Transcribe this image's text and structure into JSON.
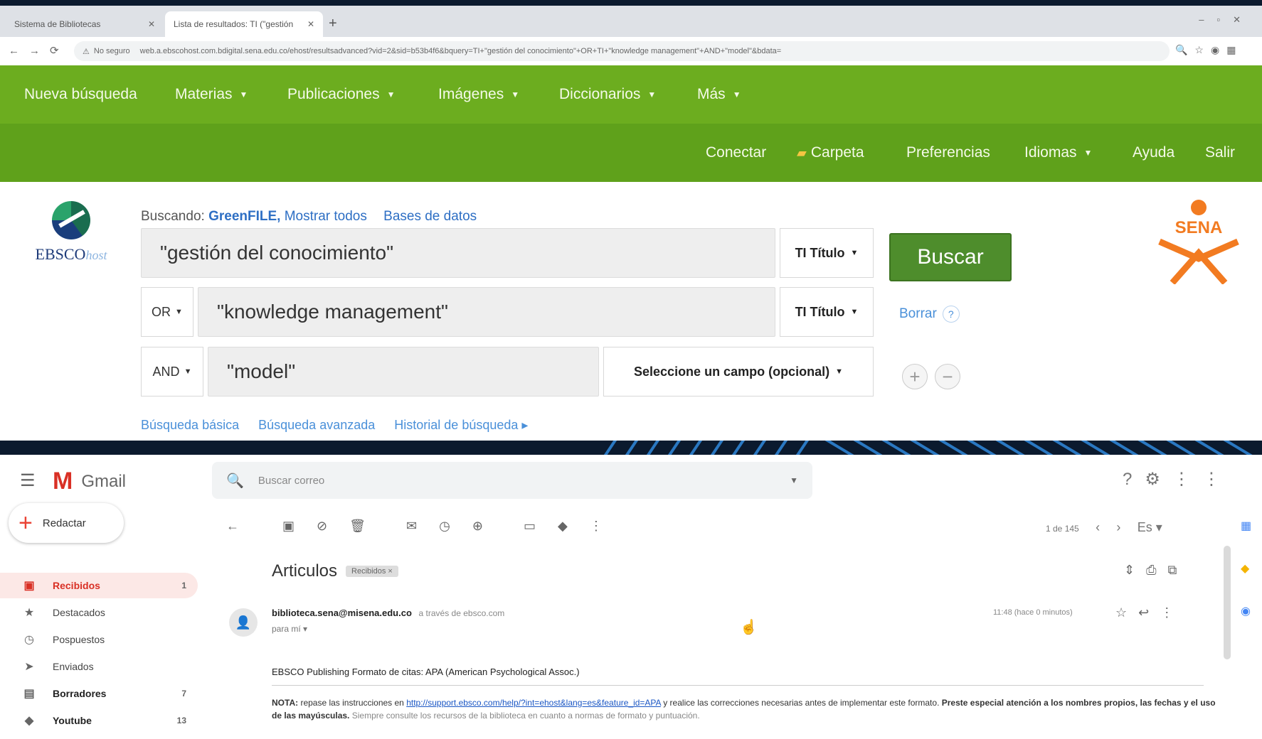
{
  "browser": {
    "tabs": [
      {
        "label": "Sistema de Bibliotecas"
      },
      {
        "label": "Lista de resultados: TI (\"gestión"
      }
    ],
    "url": "web.a.ebscohost.com.bdigital.sena.edu.co/ehost/resultsadvanced?vid=2&sid=b53b4f6&bquery=TI+\"gestión del conocimiento\"+OR+TI+\"knowledge management\"+AND+\"model\"&bdata=",
    "security_label": "No seguro"
  },
  "ebsco": {
    "topnav": [
      {
        "label": "Nueva búsqueda",
        "caret": false
      },
      {
        "label": "Materias",
        "caret": true
      },
      {
        "label": "Publicaciones",
        "caret": true
      },
      {
        "label": "Imágenes",
        "caret": true
      },
      {
        "label": "Diccionarios",
        "caret": true
      },
      {
        "label": "Más",
        "caret": true
      }
    ],
    "usernav": {
      "conectar": "Conectar",
      "carpeta": "Carpeta",
      "preferencias": "Preferencias",
      "idiomas": "Idiomas",
      "ayuda": "Ayuda",
      "salir": "Salir"
    },
    "logo": {
      "brand": "EBSCO",
      "suffix": "host"
    },
    "searching": {
      "prefix": "Buscando:",
      "database": "GreenFILE,",
      "show_all": "Mostrar todos",
      "databases": "Bases de datos"
    },
    "rows": [
      {
        "bool": "",
        "query": "\"gestión del conocimiento\"",
        "field": "TI Título"
      },
      {
        "bool": "OR",
        "query": "\"knowledge management\"",
        "field": "TI Título"
      },
      {
        "bool": "AND",
        "query": "\"model\"",
        "field": "Seleccione un campo (opcional)"
      }
    ],
    "search_button": "Buscar",
    "clear": "Borrar",
    "help": "?",
    "add_row": "+",
    "remove_row": "−",
    "bottom_links": {
      "basic": "Búsqueda básica",
      "advanced": "Búsqueda avanzada",
      "history": "Historial de búsqueda ▸"
    },
    "sena_text": "SENA"
  },
  "gmail": {
    "product": "Gmail",
    "search_placeholder": "Buscar correo",
    "compose": "Redactar",
    "nav": [
      {
        "label": "Recibidos",
        "count": "1",
        "active": true,
        "bold": true
      },
      {
        "label": "Destacados",
        "count": "",
        "active": false,
        "bold": false
      },
      {
        "label": "Pospuestos",
        "count": "",
        "active": false,
        "bold": false
      },
      {
        "label": "Enviados",
        "count": "",
        "active": false,
        "bold": false
      },
      {
        "label": "Borradores",
        "count": "7",
        "active": false,
        "bold": true
      },
      {
        "label": "Youtube",
        "count": "13",
        "active": false,
        "bold": true
      }
    ],
    "pager": "1 de 145",
    "subject": "Articulos",
    "label_chip": "Recibidos ×",
    "sender": "biblioteca.sena@misena.edu.co",
    "via": "a través de ebsco.com",
    "to": "para mí ▾",
    "time": "11:48 (hace 0 minutos)",
    "body_line1": "EBSCO Publishing    Formato de citas: APA (American Psychological Assoc.)",
    "note": {
      "prefix": "NOTA:",
      "text1": " repase las instrucciones en ",
      "link": "http://support.ebsco.com/help/?int=ehost&lang=es&feature_id=APA",
      "text2": " y realice las correcciones necesarias antes de implementar este formato.",
      "bold2": " Preste especial atención a los nombres propios, las fechas y el uso de las mayúsculas.",
      "tail": " Siempre consulte los recursos de la biblioteca en cuanto a normas de formato y puntuación."
    }
  }
}
